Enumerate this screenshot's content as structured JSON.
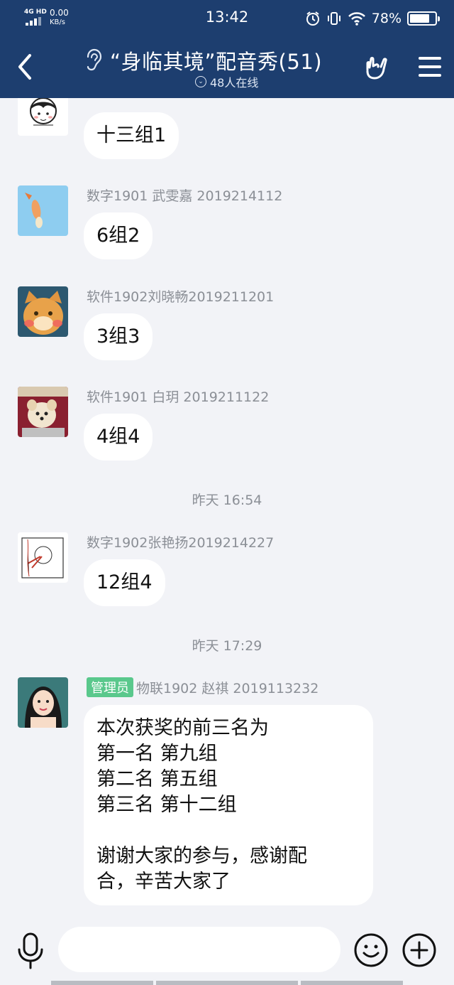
{
  "status_bar": {
    "network": "4G HD",
    "speed_value": "0.00",
    "speed_unit": "KB/s",
    "time": "13:42",
    "battery": "78%",
    "battery_level": 0.78,
    "icons": [
      "alarm-icon",
      "vibrate-icon",
      "wifi-icon",
      "battery-icon"
    ]
  },
  "nav": {
    "title": "“身临其境”配音秀(51)",
    "online": "48人在线",
    "icons": [
      "back-icon",
      "ear-icon",
      "hand-icon",
      "menu-icon"
    ]
  },
  "messages": [
    {
      "sender": "",
      "text": "十三组1"
    },
    {
      "sender": "数字1901 武雯嘉 2019214112",
      "text": "6组2"
    },
    {
      "sender": "软件1902刘晓畅2019211201",
      "text": "3组3"
    },
    {
      "sender": "软件1901 白玥 2019211122",
      "text": "4组4"
    },
    {
      "time": "昨天 16:54"
    },
    {
      "sender": "数字1902张艳扬2019214227",
      "text": "12组4"
    },
    {
      "time": "昨天 17:29"
    },
    {
      "badge": "管理员",
      "sender": "物联1902 赵祺 2019113232",
      "text": "本次获奖的前三名为\n第一名  第九组\n第二名 第五组\n第三名  第十二组\n\n谢谢大家的参与，感谢配\n合，辛苦大家了"
    }
  ],
  "input": {
    "placeholder": "",
    "icons": [
      "microphone-icon",
      "emoji-icon",
      "add-icon"
    ]
  },
  "colors": {
    "header": "#1d3e6f",
    "background": "#f2f3f7",
    "bubble": "#ffffff",
    "badge": "#5ac88c",
    "meta_text": "#8b8f96"
  }
}
